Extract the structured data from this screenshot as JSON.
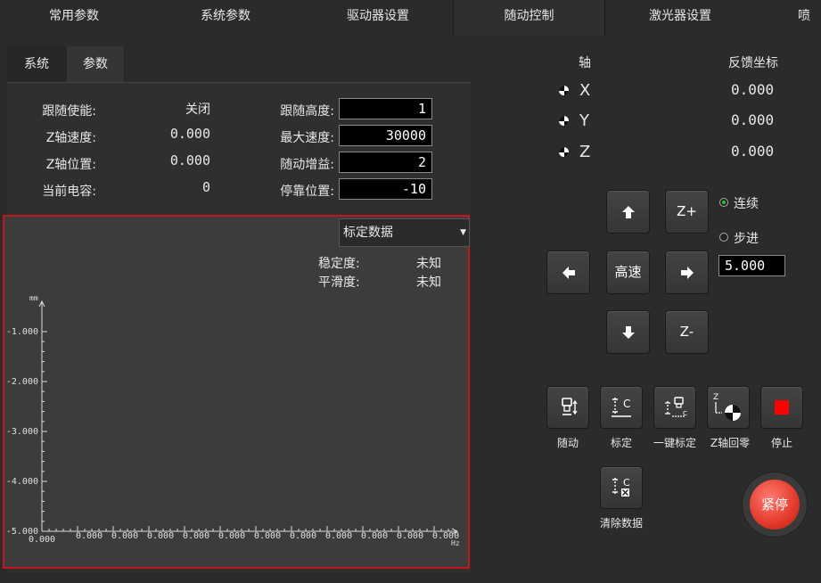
{
  "top_tabs": [
    {
      "label": "常用参数",
      "active": false
    },
    {
      "label": "系统参数",
      "active": false
    },
    {
      "label": "驱动器设置",
      "active": false
    },
    {
      "label": "随动控制",
      "active": true
    },
    {
      "label": "激光器设置",
      "active": false
    },
    {
      "label": "喷",
      "active": false
    }
  ],
  "sub_tabs": [
    {
      "label": "系统",
      "active": true
    },
    {
      "label": "参数",
      "active": false
    }
  ],
  "status": {
    "follow_enable_label": "跟随使能:",
    "follow_enable_value": "关闭",
    "z_speed_label": "Z轴速度:",
    "z_speed_value": "0.000",
    "z_pos_label": "Z轴位置:",
    "z_pos_value": "0.000",
    "capacitance_label": "当前电容:",
    "capacitance_value": "0"
  },
  "params": {
    "follow_height_label": "跟随高度:",
    "follow_height_value": "1",
    "max_speed_label": "最大速度:",
    "max_speed_value": "30000",
    "follow_gain_label": "随动增益:",
    "follow_gain_value": "2",
    "park_pos_label": "停靠位置:",
    "park_pos_value": "-10"
  },
  "calibration": {
    "dropdown_value": "标定数据",
    "stability_label": "稳定度:",
    "stability_value": "未知",
    "smoothness_label": "平滑度:",
    "smoothness_value": "未知"
  },
  "chart_data": {
    "type": "line",
    "y_unit": "mm",
    "x_unit": "Hz",
    "y_ticks": [
      "-1.000",
      "-2.000",
      "-3.000",
      "-4.000",
      "-5.000"
    ],
    "x_ticks": [
      "0.000",
      "0.000",
      "0.000",
      "0.000",
      "0.000",
      "0.000",
      "0.000",
      "0.000",
      "0.000",
      "0.000",
      "0.000",
      "0.000"
    ],
    "series": []
  },
  "coords": {
    "axis_header": "轴",
    "feedback_header": "反馈坐标",
    "axes": [
      {
        "name": "X",
        "value": "0.000"
      },
      {
        "name": "Y",
        "value": "0.000"
      },
      {
        "name": "Z",
        "value": "0.000"
      }
    ]
  },
  "jog": {
    "zplus": "Z+",
    "zminus": "Z-",
    "high_speed": "高速",
    "continuous_label": "连续",
    "step_label": "步进",
    "mode": "continuous",
    "step_value": "5.000"
  },
  "functions": {
    "follow": "随动",
    "calibrate": "标定",
    "one_key_calibrate": "一键标定",
    "z_home": "Z轴回零",
    "stop": "停止",
    "clear_data": "清除数据",
    "estop": "紧停"
  },
  "colors": {
    "accent_red": "#c0171b",
    "estop": "#e23a2a",
    "stop_square": "#ff0000",
    "radio_on": "#28c828"
  }
}
